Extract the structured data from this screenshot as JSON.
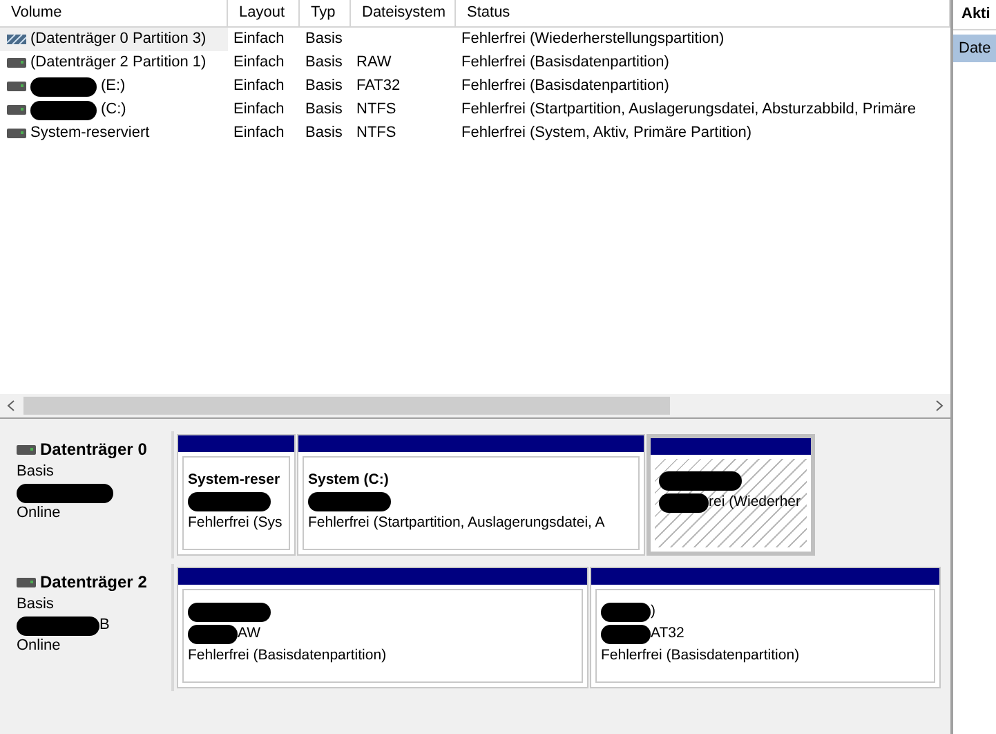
{
  "volume_list": {
    "columns": [
      "Volume",
      "Layout",
      "Typ",
      "Dateisystem",
      "Status"
    ],
    "rows": [
      {
        "kind": "recovery",
        "redacted": false,
        "name": "(Datenträger 0 Partition 3)",
        "layout": "Einfach",
        "type": "Basis",
        "filesystem": "",
        "status": "Fehlerfrei (Wiederherstellungspartition)",
        "selected": true
      },
      {
        "kind": "volume",
        "redacted": false,
        "name": "(Datenträger 2 Partition 1)",
        "layout": "Einfach",
        "type": "Basis",
        "filesystem": "RAW",
        "status": "Fehlerfrei (Basisdatenpartition)",
        "selected": false
      },
      {
        "kind": "volume",
        "redacted": true,
        "name": "(E:)",
        "layout": "Einfach",
        "type": "Basis",
        "filesystem": "FAT32",
        "status": "Fehlerfrei (Basisdatenpartition)",
        "selected": false
      },
      {
        "kind": "volume",
        "redacted": true,
        "name": "(C:)",
        "layout": "Einfach",
        "type": "Basis",
        "filesystem": "NTFS",
        "status": "Fehlerfrei (Startpartition, Auslagerungsdatei, Absturzabbild, Primäre",
        "selected": false
      },
      {
        "kind": "volume",
        "redacted": false,
        "name": "System-reserviert",
        "layout": "Einfach",
        "type": "Basis",
        "filesystem": "NTFS",
        "status": "Fehlerfrei (System, Aktiv, Primäre Partition)",
        "selected": false
      }
    ]
  },
  "disks": [
    {
      "name": "Datenträger 0",
      "info": [
        {
          "redacted": false,
          "text": "Basis"
        },
        {
          "redacted": true
        },
        {
          "redacted": false,
          "text": "Online"
        }
      ],
      "partitions": [
        {
          "selected": false,
          "title": "System-reser",
          "lines": [
            {
              "redacted": true
            },
            {
              "redacted": false,
              "text": "Fehlerfrei (Sys"
            }
          ]
        },
        {
          "selected": false,
          "title": "System  (C:)",
          "lines": [
            {
              "redacted": true
            },
            {
              "redacted": false,
              "text": "Fehlerfrei (Startpartition, Auslagerungsdatei, A"
            }
          ]
        },
        {
          "selected": true,
          "lines": [
            {
              "redacted": true
            },
            {
              "redacted": true,
              "text": "rei (Wiederher"
            }
          ]
        }
      ]
    },
    {
      "name": "Datenträger 2",
      "info": [
        {
          "redacted": false,
          "text": "Basis"
        },
        {
          "redacted": true,
          "text": "B"
        },
        {
          "redacted": false,
          "text": "Online"
        }
      ],
      "partitions": [
        {
          "selected": false,
          "lines": [
            {
              "redacted": true
            },
            {
              "redacted": true,
              "text": "AW"
            },
            {
              "redacted": false,
              "text": "Fehlerfrei (Basisdatenpartition)"
            }
          ]
        },
        {
          "selected": false,
          "lines": [
            {
              "redacted": true,
              "text": ")"
            },
            {
              "redacted": true,
              "text": "AT32"
            },
            {
              "redacted": false,
              "text": "Fehlerfrei (Basisdatenpartition)"
            }
          ]
        }
      ]
    }
  ],
  "actions": {
    "title": "Akti",
    "items": [
      {
        "label": "Date",
        "selected": true
      }
    ]
  }
}
